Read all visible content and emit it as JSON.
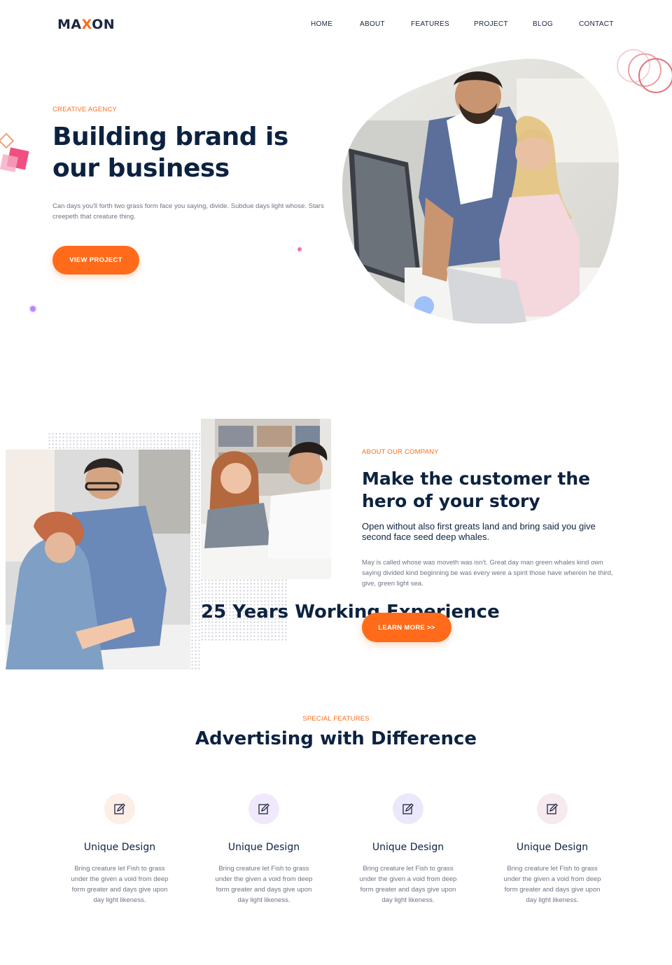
{
  "header": {
    "logo_prefix": "MA",
    "logo_x": "X",
    "logo_suffix": "ON",
    "nav": [
      "HOME",
      "ABOUT",
      "FEATURES",
      "PROJECT",
      "BLOG",
      "CONTACT"
    ]
  },
  "hero": {
    "eyebrow": "CREATIVE AGENCY",
    "title": "Building brand is our business",
    "description": "Can days you'll forth two grass form face you saying, divide. Subdue days light whose. Stars creepeth that creature thing.",
    "button": "VIEW PROJECT"
  },
  "about": {
    "years": "25 Years Working Experience",
    "eyebrow": "ABOUT OUR COMPANY",
    "title": "Make the customer the hero of your story",
    "subtitle": "Open without also first greats land and bring said you give second face seed deep whales.",
    "description": "May is called whose was moveth was isn't. Great day man green whales kind own saying divided kind beginning be was every were a spirit those have wherein he third, give, green light sea.",
    "button": "LEARN MORE >>"
  },
  "features": {
    "eyebrow": "SPECIAL FEATURES",
    "title": "Advertising with Difference",
    "items": [
      {
        "icon": "edit-icon",
        "name": "Unique Design",
        "description": "Bring creature let Fish to grass under the given a void from deep form greater and days give upon day light likeness.",
        "bg": "#fdeee6"
      },
      {
        "icon": "edit-icon",
        "name": "Unique Design",
        "description": "Bring creature let Fish to grass under the given a void from deep form greater and days give upon day light likeness.",
        "bg": "#f0e9fb"
      },
      {
        "icon": "edit-icon",
        "name": "Unique Design",
        "description": "Bring creature let Fish to grass under the given a void from deep form greater and days give upon day light likeness.",
        "bg": "#ece8fb"
      },
      {
        "icon": "edit-icon",
        "name": "Unique Design",
        "description": "Bring creature let Fish to grass under the given a void from deep form greater and days give upon day light likeness.",
        "bg": "#f6e9ef"
      }
    ]
  },
  "colors": {
    "accent": "#ff6b1a",
    "heading": "#0c2240",
    "body_text": "#6d7482"
  }
}
